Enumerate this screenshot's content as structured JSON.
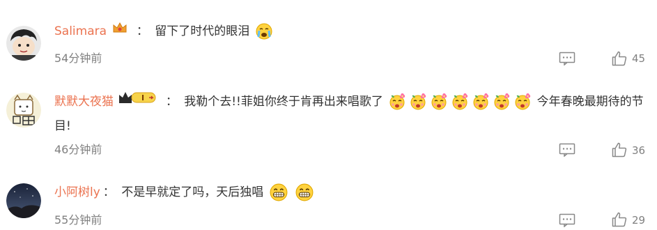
{
  "comments": [
    {
      "username": "Salimara",
      "colon": "：",
      "text": "留下了时代的眼泪",
      "time": "54分钟前",
      "likes": "45",
      "emojis": [
        "crying-emoji"
      ]
    },
    {
      "username": "默默大夜猫",
      "colon": "：",
      "text_a": "我勒个去!!菲姐你终于肯再出来唱歌了",
      "text_b": "今年春晚最期待的节目!",
      "time": "46分钟前",
      "likes": "36",
      "badge": "I",
      "emojis": [
        "flower-emoji",
        "flower-emoji",
        "flower-emoji",
        "flower-emoji",
        "flower-emoji",
        "flower-emoji",
        "flower-emoji"
      ]
    },
    {
      "username": "小阿树ly",
      "colon": "：",
      "text": "不是早就定了吗，天后独唱",
      "time": "55分钟前",
      "likes": "29",
      "emojis": [
        "grin-emoji",
        "grin-emoji"
      ]
    }
  ],
  "colors": {
    "username": "#eb7350",
    "meta": "#808080",
    "text": "#333333"
  }
}
